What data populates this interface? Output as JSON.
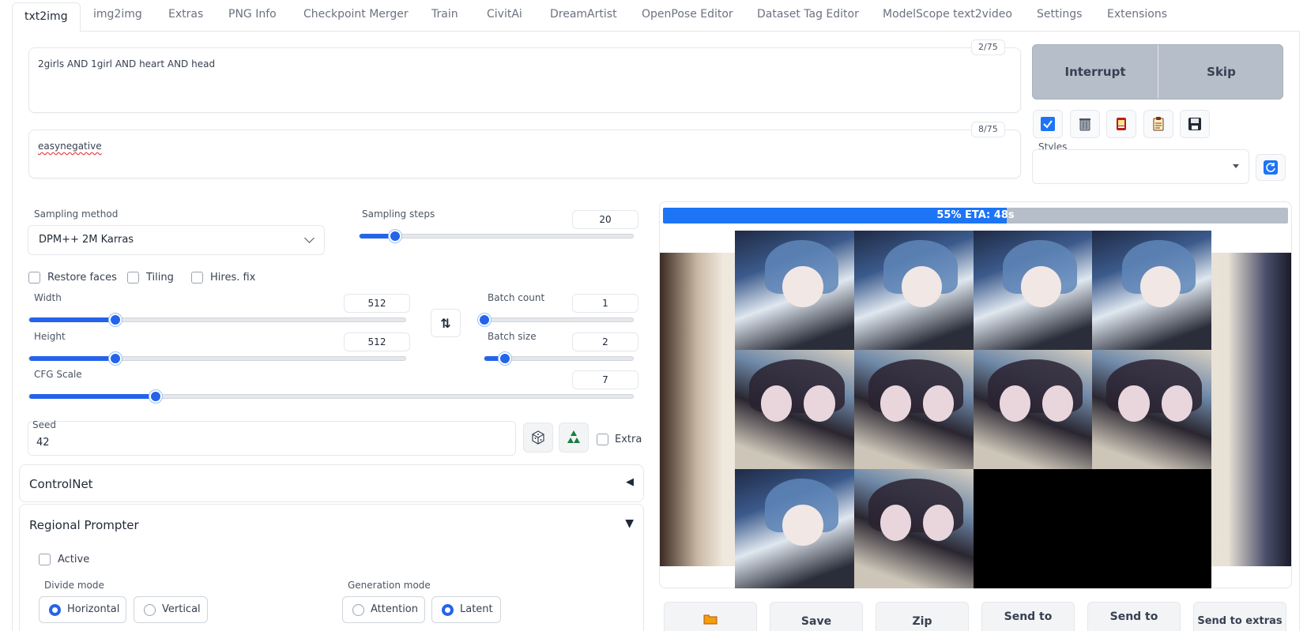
{
  "tabs": [
    "txt2img",
    "img2img",
    "Extras",
    "PNG Info",
    "Checkpoint Merger",
    "Train",
    "CivitAi",
    "DreamArtist",
    "OpenPose Editor",
    "Dataset Tag Editor",
    "ModelScope text2video",
    "Settings",
    "Extensions"
  ],
  "prompt": {
    "text": "2girls AND 1girl AND heart AND head",
    "tokens": "2/75"
  },
  "negative_prompt": {
    "text": "easynegative",
    "tokens": "8/75"
  },
  "actions": {
    "interrupt": "Interrupt",
    "skip": "Skip"
  },
  "tool_icons": [
    "checkbox-icon",
    "trash-icon",
    "card-icon",
    "clipboard-icon",
    "save-icon"
  ],
  "styles": {
    "label": "Styles",
    "value": ""
  },
  "sampling": {
    "method_label": "Sampling method",
    "method": "DPM++ 2M Karras",
    "steps_label": "Sampling steps",
    "steps": "20",
    "steps_fraction": 0.13
  },
  "options": {
    "restore_faces": "Restore faces",
    "tiling": "Tiling",
    "hires_fix": "Hires. fix"
  },
  "size": {
    "width_label": "Width",
    "width": "512",
    "width_fraction": 0.23,
    "height_label": "Height",
    "height": "512",
    "height_fraction": 0.23,
    "swap_icon": "⇅"
  },
  "batch": {
    "count_label": "Batch count",
    "count": "1",
    "count_fraction": 0.0,
    "size_label": "Batch size",
    "size": "2",
    "size_fraction": 0.14
  },
  "cfg": {
    "label": "CFG Scale",
    "value": "7",
    "fraction": 0.21
  },
  "seed": {
    "label": "Seed",
    "value": "42",
    "extra_label": "Extra"
  },
  "controlnet": {
    "title": "ControlNet",
    "arrow": "◀"
  },
  "regional_prompter": {
    "title": "Regional Prompter",
    "arrow": "▼",
    "active_label": "Active",
    "divide_mode_label": "Divide mode",
    "horizontal": "Horizontal",
    "vertical": "Vertical",
    "generation_mode_label": "Generation mode",
    "attention": "Attention",
    "latent": "Latent"
  },
  "progress": {
    "text": "55% ETA: 48s",
    "fraction": 0.55
  },
  "output_buttons": [
    "",
    "Save",
    "Zip",
    "Send to",
    "Send to",
    "Send to extras"
  ]
}
